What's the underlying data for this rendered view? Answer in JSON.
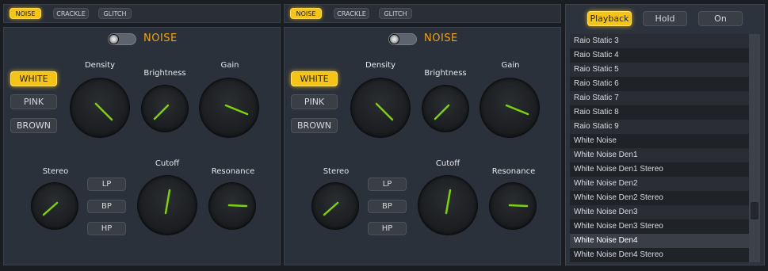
{
  "tabs": [
    {
      "noise": "NOISE",
      "crackle": "CRACKLE",
      "glitch": "GLITCH"
    },
    {
      "noise": "NOISE",
      "crackle": "CRACKLE",
      "glitch": "GLITCH"
    }
  ],
  "panels": [
    {
      "title": "NOISE",
      "color_buttons": [
        "WHITE",
        "PINK",
        "BROWN"
      ],
      "filter_buttons": [
        "LP",
        "BP",
        "HP"
      ],
      "knobs": {
        "density": "Density",
        "brightness": "Brightness",
        "gain": "Gain",
        "stereo": "Stereo",
        "cutoff": "Cutoff",
        "resonance": "Resonance"
      }
    },
    {
      "title": "NOISE",
      "color_buttons": [
        "WHITE",
        "PINK",
        "BROWN"
      ],
      "filter_buttons": [
        "LP",
        "BP",
        "HP"
      ],
      "knobs": {
        "density": "Density",
        "brightness": "Brightness",
        "gain": "Gain",
        "stereo": "Stereo",
        "cutoff": "Cutoff",
        "resonance": "Resonance"
      }
    }
  ],
  "right": {
    "playback": "Playback",
    "hold": "Hold",
    "on": "On",
    "items": [
      "Raio Static 3",
      "Raio Static 4",
      "Raio Static 5",
      "Raio Static 6",
      "Raio Static 7",
      "Raio Static 8",
      "Raio Static 9",
      "White Noise",
      "White Noise Den1",
      "White Noise Den1 Stereo",
      "White Noise Den2",
      "White Noise Den2 Stereo",
      "White Noise Den3",
      "White Noise Den3 Stereo",
      "White Noise Den4",
      "White Noise Den4 Stereo"
    ],
    "selected_index": 14
  },
  "colors": {
    "accent": "#f6c419",
    "title": "#f0a21a",
    "indicator": "#7cd20b"
  }
}
